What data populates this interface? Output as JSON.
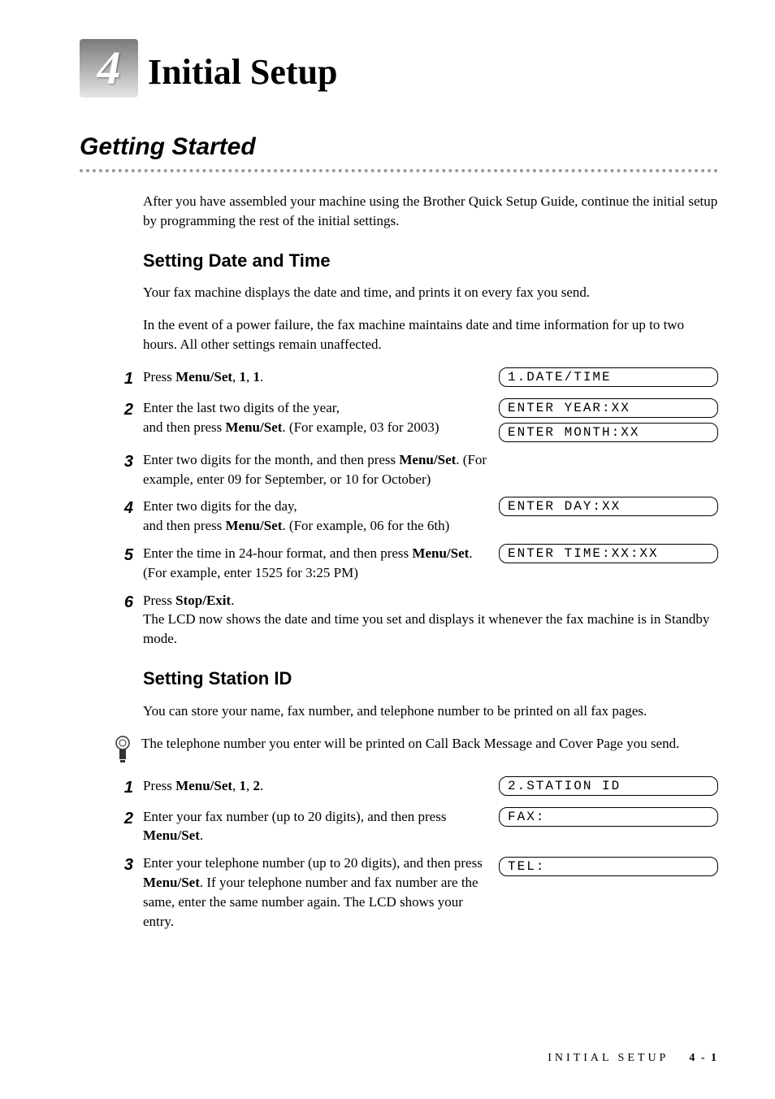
{
  "chapter": {
    "number": "4",
    "title": "Initial Setup"
  },
  "section": {
    "title": "Getting Started"
  },
  "intro": "After you have assembled your machine using the Brother Quick Setup Guide, continue the initial setup by programming the rest of the initial settings.",
  "datetime": {
    "heading": "Setting Date and Time",
    "p1": "Your fax machine displays the date and time, and prints it on every fax you send.",
    "p2": "In the event of a power failure, the fax machine maintains date and time information for up to two hours. All other settings remain unaffected.",
    "steps": {
      "s1_a": "Press ",
      "s1_b": "Menu/Set",
      "s1_c": ", ",
      "s1_d": "1",
      "s1_e": ", ",
      "s1_f": "1",
      "s1_g": ".",
      "s2_a": "Enter the last two digits of the year,",
      "s2_b": "and then press ",
      "s2_c": "Menu/Set",
      "s2_d": ". (For example, 03 for 2003)",
      "s3_a": "Enter two digits for the month, and then press ",
      "s3_b": "Menu/Set",
      "s3_c": ". (For example, enter 09 for September, or 10 for October)",
      "s4_a": "Enter two digits for the day,",
      "s4_b": "and then press ",
      "s4_c": "Menu/Set",
      "s4_d": ". (For example, 06 for the 6th)",
      "s5_a": "Enter the time in 24-hour format, and then press ",
      "s5_b": "Menu/Set",
      "s5_c": ". (For example, enter 1525 for 3:25 PM)",
      "s6_a": "Press ",
      "s6_b": "Stop/Exit",
      "s6_c": ".",
      "s6_follow": "The LCD now shows the date and time you set and displays it whenever the fax machine is in Standby mode."
    },
    "lcd": {
      "l1": "1.DATE/TIME",
      "l2": "ENTER YEAR:XX",
      "l3": "ENTER MONTH:XX",
      "l4": "ENTER DAY:XX",
      "l5": "ENTER TIME:XX:XX"
    }
  },
  "station": {
    "heading": "Setting Station ID",
    "p1": "You can store your name, fax number, and telephone number to be printed on all fax pages.",
    "note": "The telephone number you enter will be printed on Call Back Message and Cover Page you send.",
    "steps": {
      "s1_a": "Press ",
      "s1_b": "Menu/Set",
      "s1_c": ", ",
      "s1_d": "1",
      "s1_e": ", ",
      "s1_f": "2",
      "s1_g": ".",
      "s2_a": "Enter your fax number (up to 20 digits), and then press ",
      "s2_b": "Menu/Set",
      "s2_c": ".",
      "s3_a": "Enter your telephone number (up to 20 digits), and then press ",
      "s3_b": "Menu/Set",
      "s3_c": ". If your telephone number and fax number are the same, enter the same number again. The LCD shows your entry."
    },
    "lcd": {
      "l1": "2.STATION ID",
      "l2": "FAX:",
      "l3": "TEL:"
    }
  },
  "footer": {
    "section": "INITIAL SETUP",
    "page": "4 - 1"
  }
}
